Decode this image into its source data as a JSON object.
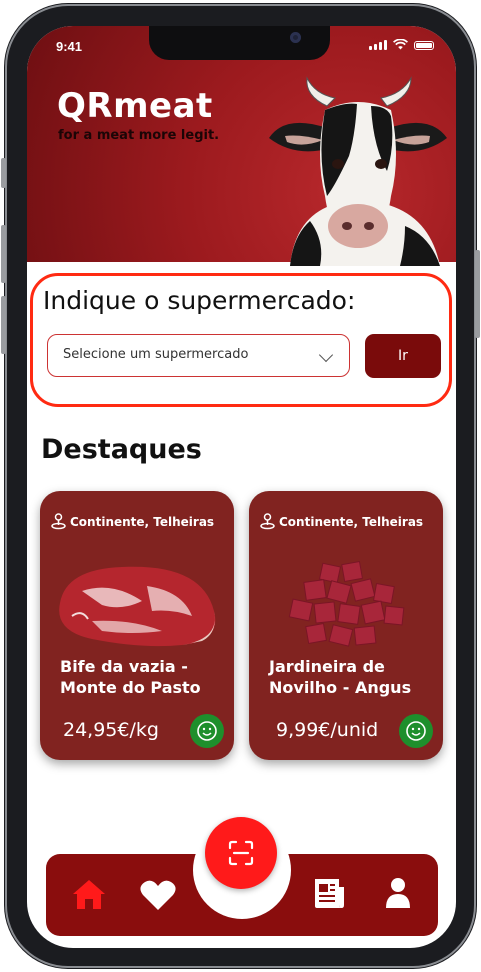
{
  "status_bar": {
    "time": "9:41"
  },
  "header": {
    "brand": "QRmeat",
    "tagline": "for a meat more legit."
  },
  "supermarket": {
    "title": "Indique o supermercado:",
    "select_value": "Selecione um supermercado",
    "go_label": "Ir"
  },
  "highlights": {
    "title": "Destaques",
    "cards": [
      {
        "location": "Continente, Telheiras",
        "name": "Bife da vazia - Monte do Pasto",
        "price": "24,95€/kg"
      },
      {
        "location": "Continente, Telheiras",
        "name": "Jardineira de Novilho - Angus",
        "price": "9,99€/unid"
      }
    ]
  },
  "nav": {
    "items": [
      "home-icon",
      "heart-icon",
      "qr-scan-icon",
      "news-icon",
      "profile-icon"
    ],
    "active": "home-icon"
  },
  "colors": {
    "brand_red": "#9c1a1e",
    "card": "#812320",
    "nav": "#8a0d0d",
    "accent": "#ff1a1a",
    "badge_green": "#1e8f2c"
  }
}
